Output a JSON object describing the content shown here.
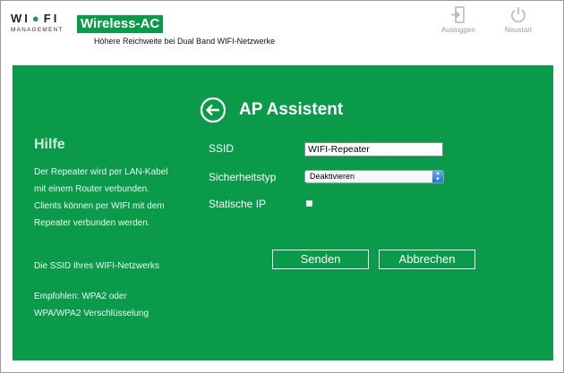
{
  "header": {
    "logo_main_left": "WI",
    "logo_main_right": "FI",
    "logo_sub": "MANAGEMENT",
    "product_title": "Wireless-AC",
    "product_subtitle": "Höhere Reichweite bei Dual Band WIFI-Netzwerke",
    "logout_label": "Ausloggen",
    "restart_label": "Neustart"
  },
  "page": {
    "title": "AP Assistent"
  },
  "help": {
    "title": "Hilfe",
    "text1": "Der Repeater wird per LAN-Kabel mit einem Router verbunden. Clients können per WIFI mit dem Repeater verbunden werden.",
    "text2": "Die SSID Ihres WIFI-Netzwerks",
    "text3": "Empfohlen: WPA2 oder WPA/WPA2 Verschlüsselung"
  },
  "form": {
    "ssid_label": "SSID",
    "ssid_value": "WIFI-Repeater",
    "security_label": "Sicherheitstyp",
    "security_value": "Deaktivieren",
    "static_ip_label": "Statische IP",
    "static_ip_checked": false
  },
  "buttons": {
    "send_label": "Senden",
    "cancel_label": "Abbrechen"
  },
  "colors": {
    "brand_green": "#0b9a4a",
    "header_icon_gray": "#9b9b9b"
  }
}
